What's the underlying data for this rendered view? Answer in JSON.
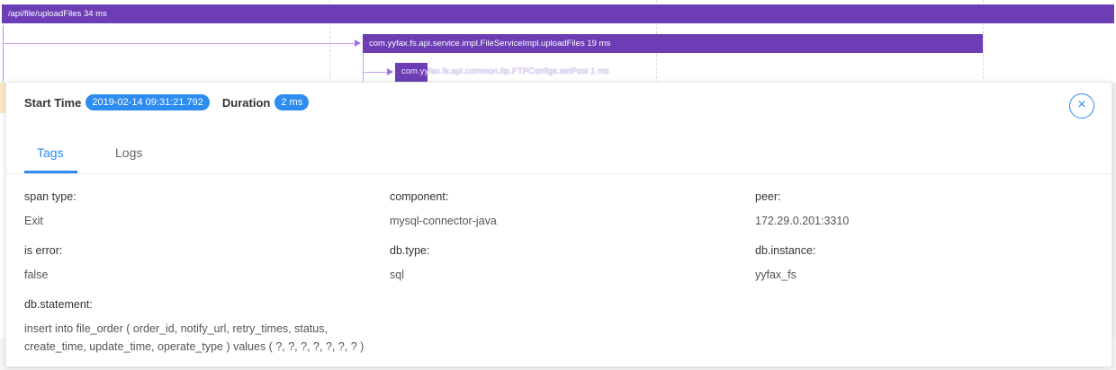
{
  "trace": {
    "root_span": "/api/file/uploadFiles 34 ms",
    "child_span": "com.yyfax.fs.api.service.impl.FileServiceImpl.uploadFiles 19 ms",
    "grandchild_span": "com.yyfax.fs.api.common.ftp.FTPConfigs.setPool 1 ms",
    "span_color": "#6c3db5"
  },
  "panel": {
    "start_time_label": "Start Time",
    "start_time_value": "2019-02-14 09:31:21.792",
    "duration_label": "Duration",
    "duration_value": "2 ms",
    "close_icon": "close-circle-icon",
    "accent_color": "#2d8cf0"
  },
  "tabs": [
    {
      "label": "Tags",
      "active": true
    },
    {
      "label": "Logs",
      "active": false
    }
  ],
  "tags": {
    "span_type": {
      "key": "span type:",
      "value": "Exit"
    },
    "component": {
      "key": "component:",
      "value": "mysql-connector-java"
    },
    "peer": {
      "key": "peer:",
      "value": "172.29.0.201:3310"
    },
    "is_error": {
      "key": "is error:",
      "value": "false"
    },
    "db_type": {
      "key": "db.type:",
      "value": "sql"
    },
    "db_instance": {
      "key": "db.instance:",
      "value": "yyfax_fs"
    },
    "db_statement": {
      "key": "db.statement:",
      "value": "insert into file_order ( order_id, notify_url, retry_times, status, create_time, update_time, operate_type ) values ( ?, ?, ?, ?, ?, ?, ? )"
    }
  }
}
